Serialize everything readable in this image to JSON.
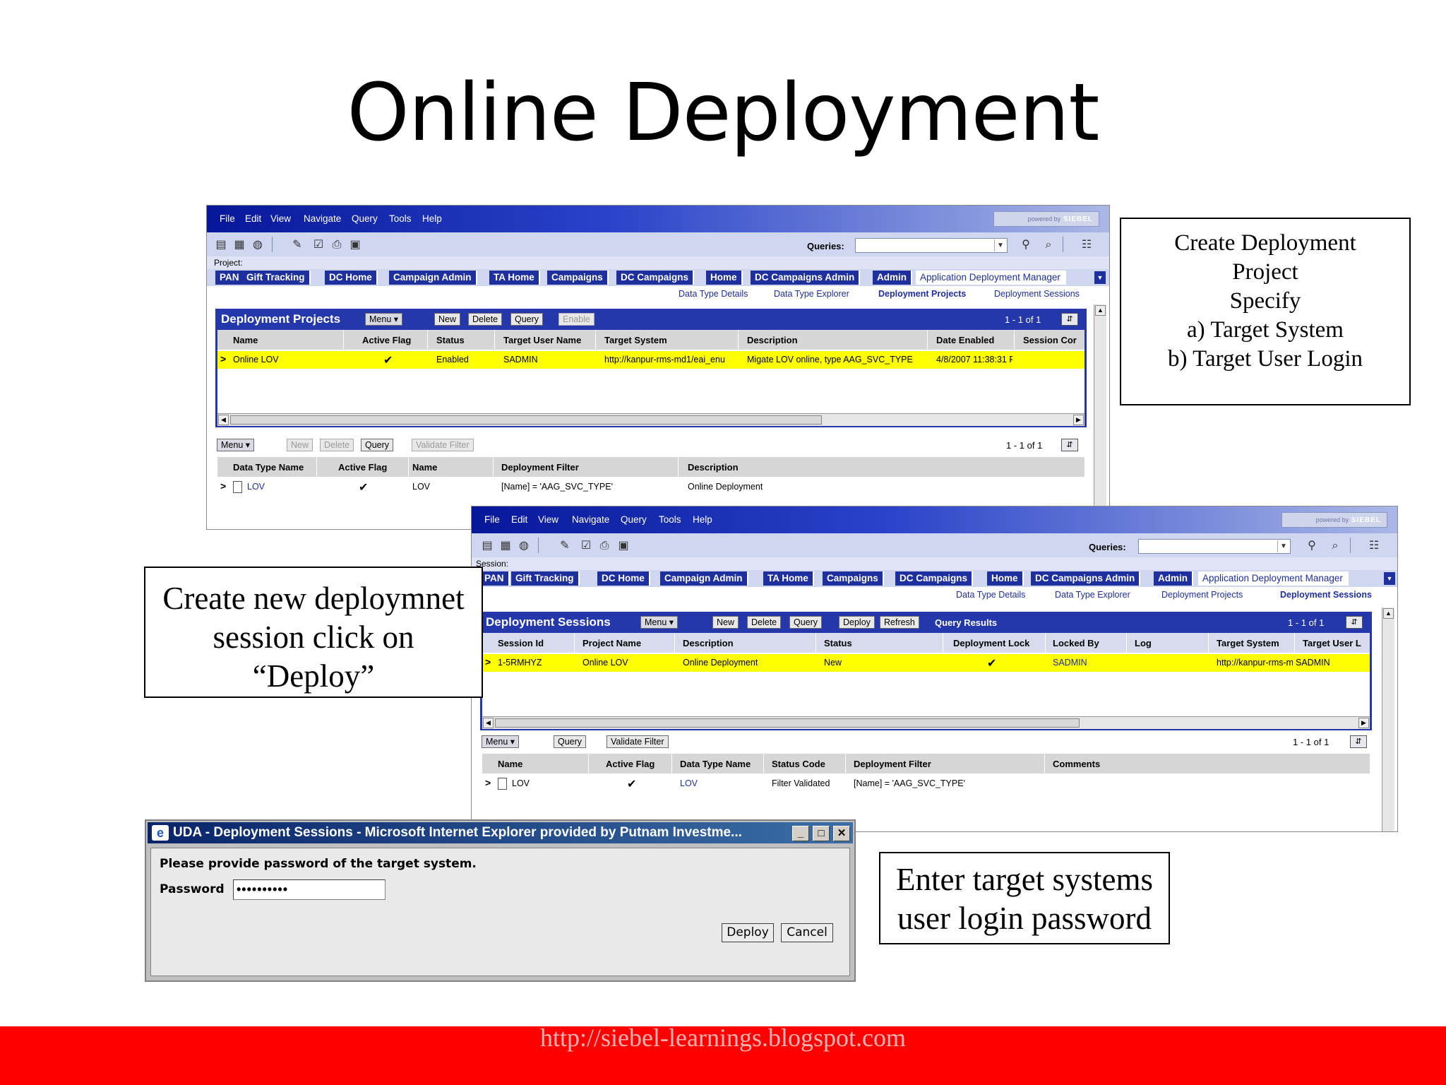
{
  "slide": {
    "title": "Online Deployment",
    "footer_url": "http://siebel-learnings.blogspot.com"
  },
  "callouts": {
    "top_right": [
      "Create Deployment",
      "Project",
      "Specify",
      "a) Target System",
      "b) Target User Login"
    ],
    "left": [
      "Create new deploymnet",
      "session  click on",
      "“Deploy”"
    ],
    "bottom_right": [
      "Enter target systems",
      "user login password"
    ]
  },
  "app": {
    "menu": [
      "File",
      "Edit",
      "View",
      "Navigate",
      "Query",
      "Tools",
      "Help"
    ],
    "powered_by": "powered by",
    "brand": "SIEBEL",
    "queries_label": "Queries:",
    "tabs": [
      "PAN",
      "Gift Tracking",
      "DC Home",
      "Campaign Admin",
      "TA Home",
      "Campaigns",
      "DC Campaigns",
      "Home",
      "DC Campaigns Admin",
      "Admin",
      "Application Deployment Manager"
    ],
    "subtabs": [
      "Data Type Details",
      "Data Type Explorer",
      "Deployment Projects",
      "Deployment Sessions"
    ],
    "menu_btn": "Menu ▾"
  },
  "win1": {
    "crumb": "Project:",
    "applet_title": "Deployment Projects",
    "buttons": {
      "new": "New",
      "delete": "Delete",
      "query": "Query",
      "enable": "Enable"
    },
    "rec_count": "1 - 1 of 1",
    "columns": [
      "Name",
      "Active Flag",
      "Status",
      "Target User Name",
      "Target System",
      "Description",
      "Date Enabled",
      "Session Cor"
    ],
    "row": {
      "name": "Online LOV",
      "active": "✔",
      "status": "Enabled",
      "target_user": "SADMIN",
      "target_system": "http://kanpur-rms-md1/eai_enu",
      "description": "Migate LOV online, type AAG_SVC_TYPE",
      "date_enabled": "4/8/2007 11:38:31 P"
    },
    "lower_buttons": {
      "new": "New",
      "delete": "Delete",
      "query": "Query",
      "validate": "Validate Filter"
    },
    "lower_rec_count": "1 - 1 of 1",
    "lower_columns": [
      "Data Type Name",
      "Active Flag",
      "Name",
      "Deployment Filter",
      "Description"
    ],
    "lower_row": {
      "data_type": "LOV",
      "active": "✔",
      "name": "LOV",
      "filter": "[Name] = 'AAG_SVC_TYPE'",
      "description": "Online Deployment"
    }
  },
  "win2": {
    "crumb": "Session:",
    "applet_title": "Deployment Sessions",
    "buttons": {
      "new": "New",
      "delete": "Delete",
      "query": "Query",
      "deploy": "Deploy",
      "refresh": "Refresh"
    },
    "query_results": "Query Results",
    "rec_count": "1 - 1 of 1",
    "columns": [
      "Session Id",
      "Project Name",
      "Description",
      "Status",
      "Deployment Lock",
      "Locked By",
      "Log",
      "Target System",
      "Target User L"
    ],
    "row": {
      "session_id": "1-5RMHYZ",
      "project": "Online LOV",
      "description": "Online Deployment",
      "status": "New",
      "lock": "✔",
      "locked_by": "SADMIN",
      "target_system": "http://kanpur-rms-mc",
      "target_user": "SADMIN"
    },
    "lower_buttons": {
      "query": "Query",
      "validate": "Validate Filter"
    },
    "lower_rec_count": "1 - 1 of 1",
    "lower_columns": [
      "Name",
      "Active Flag",
      "Data Type Name",
      "Status Code",
      "Deployment Filter",
      "Comments"
    ],
    "lower_row": {
      "name": "LOV",
      "active": "✔",
      "data_type": "LOV",
      "status_code": "Filter Validated",
      "filter": "[Name] = 'AAG_SVC_TYPE'"
    }
  },
  "dialog": {
    "title": "UDA - Deployment Sessions - Microsoft Internet Explorer provided by Putnam Investme...",
    "message": "Please provide password of the target system.",
    "password_label": "Password",
    "password_value": "••••••••••",
    "deploy_label": "Deploy",
    "cancel_label": "Cancel"
  }
}
